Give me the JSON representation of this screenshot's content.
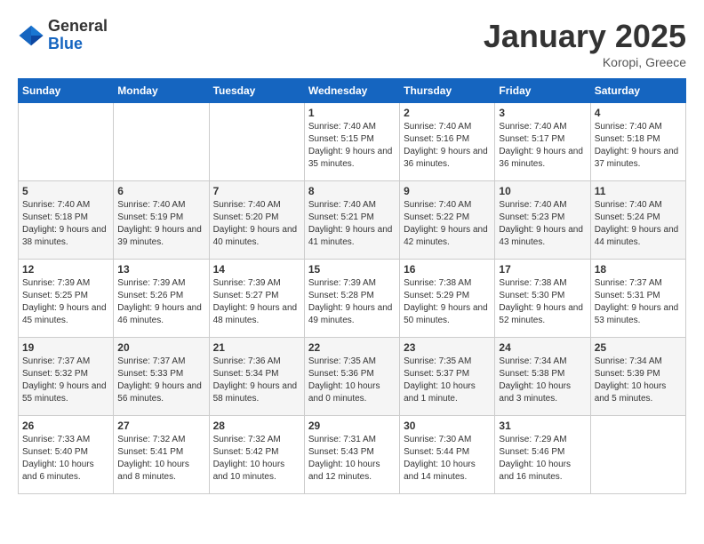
{
  "logo": {
    "general": "General",
    "blue": "Blue"
  },
  "title": "January 2025",
  "location": "Koropi, Greece",
  "days_header": [
    "Sunday",
    "Monday",
    "Tuesday",
    "Wednesday",
    "Thursday",
    "Friday",
    "Saturday"
  ],
  "weeks": [
    [
      {
        "day": "",
        "content": ""
      },
      {
        "day": "",
        "content": ""
      },
      {
        "day": "",
        "content": ""
      },
      {
        "day": "1",
        "content": "Sunrise: 7:40 AM\nSunset: 5:15 PM\nDaylight: 9 hours\nand 35 minutes."
      },
      {
        "day": "2",
        "content": "Sunrise: 7:40 AM\nSunset: 5:16 PM\nDaylight: 9 hours\nand 36 minutes."
      },
      {
        "day": "3",
        "content": "Sunrise: 7:40 AM\nSunset: 5:17 PM\nDaylight: 9 hours\nand 36 minutes."
      },
      {
        "day": "4",
        "content": "Sunrise: 7:40 AM\nSunset: 5:18 PM\nDaylight: 9 hours\nand 37 minutes."
      }
    ],
    [
      {
        "day": "5",
        "content": "Sunrise: 7:40 AM\nSunset: 5:18 PM\nDaylight: 9 hours\nand 38 minutes."
      },
      {
        "day": "6",
        "content": "Sunrise: 7:40 AM\nSunset: 5:19 PM\nDaylight: 9 hours\nand 39 minutes."
      },
      {
        "day": "7",
        "content": "Sunrise: 7:40 AM\nSunset: 5:20 PM\nDaylight: 9 hours\nand 40 minutes."
      },
      {
        "day": "8",
        "content": "Sunrise: 7:40 AM\nSunset: 5:21 PM\nDaylight: 9 hours\nand 41 minutes."
      },
      {
        "day": "9",
        "content": "Sunrise: 7:40 AM\nSunset: 5:22 PM\nDaylight: 9 hours\nand 42 minutes."
      },
      {
        "day": "10",
        "content": "Sunrise: 7:40 AM\nSunset: 5:23 PM\nDaylight: 9 hours\nand 43 minutes."
      },
      {
        "day": "11",
        "content": "Sunrise: 7:40 AM\nSunset: 5:24 PM\nDaylight: 9 hours\nand 44 minutes."
      }
    ],
    [
      {
        "day": "12",
        "content": "Sunrise: 7:39 AM\nSunset: 5:25 PM\nDaylight: 9 hours\nand 45 minutes."
      },
      {
        "day": "13",
        "content": "Sunrise: 7:39 AM\nSunset: 5:26 PM\nDaylight: 9 hours\nand 46 minutes."
      },
      {
        "day": "14",
        "content": "Sunrise: 7:39 AM\nSunset: 5:27 PM\nDaylight: 9 hours\nand 48 minutes."
      },
      {
        "day": "15",
        "content": "Sunrise: 7:39 AM\nSunset: 5:28 PM\nDaylight: 9 hours\nand 49 minutes."
      },
      {
        "day": "16",
        "content": "Sunrise: 7:38 AM\nSunset: 5:29 PM\nDaylight: 9 hours\nand 50 minutes."
      },
      {
        "day": "17",
        "content": "Sunrise: 7:38 AM\nSunset: 5:30 PM\nDaylight: 9 hours\nand 52 minutes."
      },
      {
        "day": "18",
        "content": "Sunrise: 7:37 AM\nSunset: 5:31 PM\nDaylight: 9 hours\nand 53 minutes."
      }
    ],
    [
      {
        "day": "19",
        "content": "Sunrise: 7:37 AM\nSunset: 5:32 PM\nDaylight: 9 hours\nand 55 minutes."
      },
      {
        "day": "20",
        "content": "Sunrise: 7:37 AM\nSunset: 5:33 PM\nDaylight: 9 hours\nand 56 minutes."
      },
      {
        "day": "21",
        "content": "Sunrise: 7:36 AM\nSunset: 5:34 PM\nDaylight: 9 hours\nand 58 minutes."
      },
      {
        "day": "22",
        "content": "Sunrise: 7:35 AM\nSunset: 5:36 PM\nDaylight: 10 hours\nand 0 minutes."
      },
      {
        "day": "23",
        "content": "Sunrise: 7:35 AM\nSunset: 5:37 PM\nDaylight: 10 hours\nand 1 minute."
      },
      {
        "day": "24",
        "content": "Sunrise: 7:34 AM\nSunset: 5:38 PM\nDaylight: 10 hours\nand 3 minutes."
      },
      {
        "day": "25",
        "content": "Sunrise: 7:34 AM\nSunset: 5:39 PM\nDaylight: 10 hours\nand 5 minutes."
      }
    ],
    [
      {
        "day": "26",
        "content": "Sunrise: 7:33 AM\nSunset: 5:40 PM\nDaylight: 10 hours\nand 6 minutes."
      },
      {
        "day": "27",
        "content": "Sunrise: 7:32 AM\nSunset: 5:41 PM\nDaylight: 10 hours\nand 8 minutes."
      },
      {
        "day": "28",
        "content": "Sunrise: 7:32 AM\nSunset: 5:42 PM\nDaylight: 10 hours\nand 10 minutes."
      },
      {
        "day": "29",
        "content": "Sunrise: 7:31 AM\nSunset: 5:43 PM\nDaylight: 10 hours\nand 12 minutes."
      },
      {
        "day": "30",
        "content": "Sunrise: 7:30 AM\nSunset: 5:44 PM\nDaylight: 10 hours\nand 14 minutes."
      },
      {
        "day": "31",
        "content": "Sunrise: 7:29 AM\nSunset: 5:46 PM\nDaylight: 10 hours\nand 16 minutes."
      },
      {
        "day": "",
        "content": ""
      }
    ]
  ]
}
